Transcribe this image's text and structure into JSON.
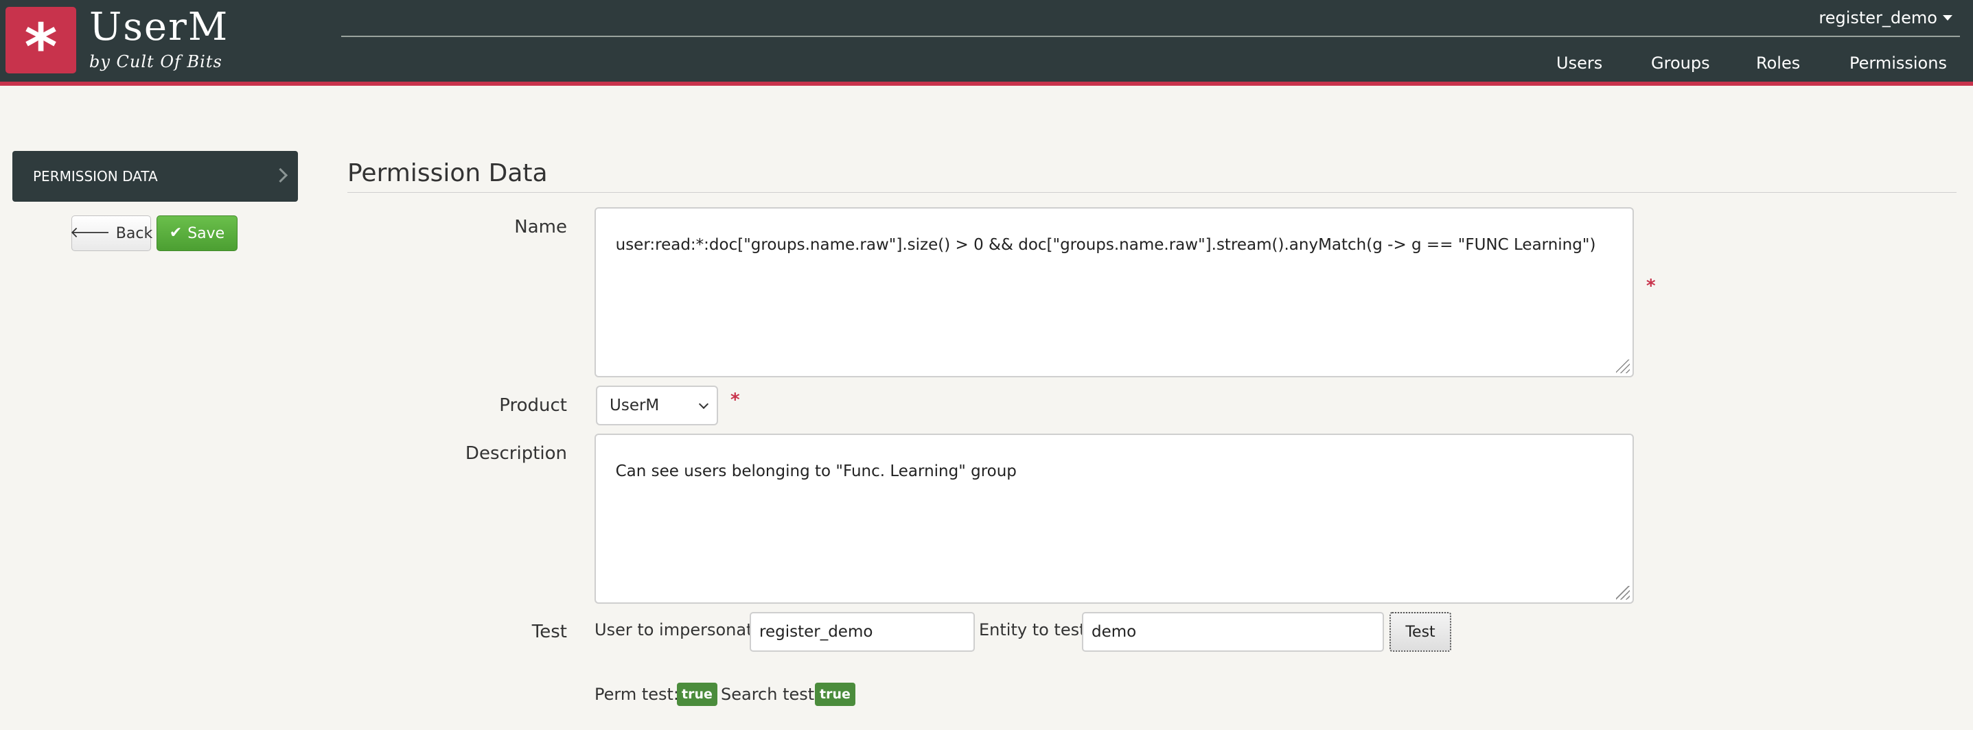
{
  "header": {
    "logo_glyph": "*",
    "brand_title": "UserM",
    "brand_subtitle": "by Cult Of Bits",
    "user_menu": "register_demo",
    "nav": [
      "Users",
      "Groups",
      "Roles",
      "Permissions"
    ]
  },
  "sidebar": {
    "panel_label": "PERMISSION DATA",
    "back_label": "Back",
    "save_label": "Save"
  },
  "form": {
    "title": "Permission Data",
    "name_label": "Name",
    "name_value": "user:read:*:doc[\"groups.name.raw\"].size() > 0 && doc[\"groups.name.raw\"].stream().anyMatch(g -> g == \"FUNC Learning\")",
    "required_mark": "*",
    "product_label": "Product",
    "product_value": "UserM",
    "description_label": "Description",
    "description_value": "Can see users belonging to \"Func. Learning\" group",
    "test_label": "Test",
    "impersonate_label": "User to impersonate",
    "impersonate_value": "register_demo",
    "entity_label": "Entity to test",
    "entity_value": "demo",
    "test_button": "Test",
    "perm_test_label": "Perm test:",
    "perm_test_value": "true",
    "search_test_label": "Search test:",
    "search_test_value": "true"
  },
  "colors": {
    "header_bg": "#2f3b3d",
    "accent": "#c8334c",
    "save_green": "#4c9f32",
    "badge_green": "#4b8c3c"
  }
}
